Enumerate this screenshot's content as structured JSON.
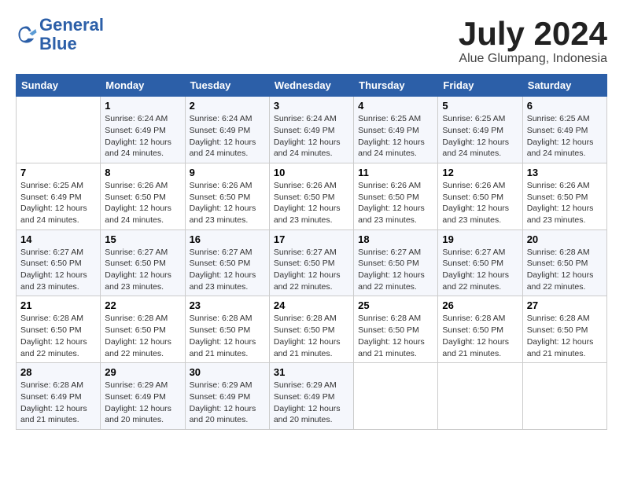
{
  "header": {
    "logo_line1": "General",
    "logo_line2": "Blue",
    "month_year": "July 2024",
    "location": "Alue Glumpang, Indonesia"
  },
  "days_of_week": [
    "Sunday",
    "Monday",
    "Tuesday",
    "Wednesday",
    "Thursday",
    "Friday",
    "Saturday"
  ],
  "weeks": [
    [
      {
        "day": "",
        "info": ""
      },
      {
        "day": "1",
        "info": "Sunrise: 6:24 AM\nSunset: 6:49 PM\nDaylight: 12 hours\nand 24 minutes."
      },
      {
        "day": "2",
        "info": "Sunrise: 6:24 AM\nSunset: 6:49 PM\nDaylight: 12 hours\nand 24 minutes."
      },
      {
        "day": "3",
        "info": "Sunrise: 6:24 AM\nSunset: 6:49 PM\nDaylight: 12 hours\nand 24 minutes."
      },
      {
        "day": "4",
        "info": "Sunrise: 6:25 AM\nSunset: 6:49 PM\nDaylight: 12 hours\nand 24 minutes."
      },
      {
        "day": "5",
        "info": "Sunrise: 6:25 AM\nSunset: 6:49 PM\nDaylight: 12 hours\nand 24 minutes."
      },
      {
        "day": "6",
        "info": "Sunrise: 6:25 AM\nSunset: 6:49 PM\nDaylight: 12 hours\nand 24 minutes."
      }
    ],
    [
      {
        "day": "7",
        "info": "Sunrise: 6:25 AM\nSunset: 6:49 PM\nDaylight: 12 hours\nand 24 minutes."
      },
      {
        "day": "8",
        "info": "Sunrise: 6:26 AM\nSunset: 6:50 PM\nDaylight: 12 hours\nand 24 minutes."
      },
      {
        "day": "9",
        "info": "Sunrise: 6:26 AM\nSunset: 6:50 PM\nDaylight: 12 hours\nand 23 minutes."
      },
      {
        "day": "10",
        "info": "Sunrise: 6:26 AM\nSunset: 6:50 PM\nDaylight: 12 hours\nand 23 minutes."
      },
      {
        "day": "11",
        "info": "Sunrise: 6:26 AM\nSunset: 6:50 PM\nDaylight: 12 hours\nand 23 minutes."
      },
      {
        "day": "12",
        "info": "Sunrise: 6:26 AM\nSunset: 6:50 PM\nDaylight: 12 hours\nand 23 minutes."
      },
      {
        "day": "13",
        "info": "Sunrise: 6:26 AM\nSunset: 6:50 PM\nDaylight: 12 hours\nand 23 minutes."
      }
    ],
    [
      {
        "day": "14",
        "info": "Sunrise: 6:27 AM\nSunset: 6:50 PM\nDaylight: 12 hours\nand 23 minutes."
      },
      {
        "day": "15",
        "info": "Sunrise: 6:27 AM\nSunset: 6:50 PM\nDaylight: 12 hours\nand 23 minutes."
      },
      {
        "day": "16",
        "info": "Sunrise: 6:27 AM\nSunset: 6:50 PM\nDaylight: 12 hours\nand 23 minutes."
      },
      {
        "day": "17",
        "info": "Sunrise: 6:27 AM\nSunset: 6:50 PM\nDaylight: 12 hours\nand 22 minutes."
      },
      {
        "day": "18",
        "info": "Sunrise: 6:27 AM\nSunset: 6:50 PM\nDaylight: 12 hours\nand 22 minutes."
      },
      {
        "day": "19",
        "info": "Sunrise: 6:27 AM\nSunset: 6:50 PM\nDaylight: 12 hours\nand 22 minutes."
      },
      {
        "day": "20",
        "info": "Sunrise: 6:28 AM\nSunset: 6:50 PM\nDaylight: 12 hours\nand 22 minutes."
      }
    ],
    [
      {
        "day": "21",
        "info": "Sunrise: 6:28 AM\nSunset: 6:50 PM\nDaylight: 12 hours\nand 22 minutes."
      },
      {
        "day": "22",
        "info": "Sunrise: 6:28 AM\nSunset: 6:50 PM\nDaylight: 12 hours\nand 22 minutes."
      },
      {
        "day": "23",
        "info": "Sunrise: 6:28 AM\nSunset: 6:50 PM\nDaylight: 12 hours\nand 21 minutes."
      },
      {
        "day": "24",
        "info": "Sunrise: 6:28 AM\nSunset: 6:50 PM\nDaylight: 12 hours\nand 21 minutes."
      },
      {
        "day": "25",
        "info": "Sunrise: 6:28 AM\nSunset: 6:50 PM\nDaylight: 12 hours\nand 21 minutes."
      },
      {
        "day": "26",
        "info": "Sunrise: 6:28 AM\nSunset: 6:50 PM\nDaylight: 12 hours\nand 21 minutes."
      },
      {
        "day": "27",
        "info": "Sunrise: 6:28 AM\nSunset: 6:50 PM\nDaylight: 12 hours\nand 21 minutes."
      }
    ],
    [
      {
        "day": "28",
        "info": "Sunrise: 6:28 AM\nSunset: 6:49 PM\nDaylight: 12 hours\nand 21 minutes."
      },
      {
        "day": "29",
        "info": "Sunrise: 6:29 AM\nSunset: 6:49 PM\nDaylight: 12 hours\nand 20 minutes."
      },
      {
        "day": "30",
        "info": "Sunrise: 6:29 AM\nSunset: 6:49 PM\nDaylight: 12 hours\nand 20 minutes."
      },
      {
        "day": "31",
        "info": "Sunrise: 6:29 AM\nSunset: 6:49 PM\nDaylight: 12 hours\nand 20 minutes."
      },
      {
        "day": "",
        "info": ""
      },
      {
        "day": "",
        "info": ""
      },
      {
        "day": "",
        "info": ""
      }
    ]
  ]
}
